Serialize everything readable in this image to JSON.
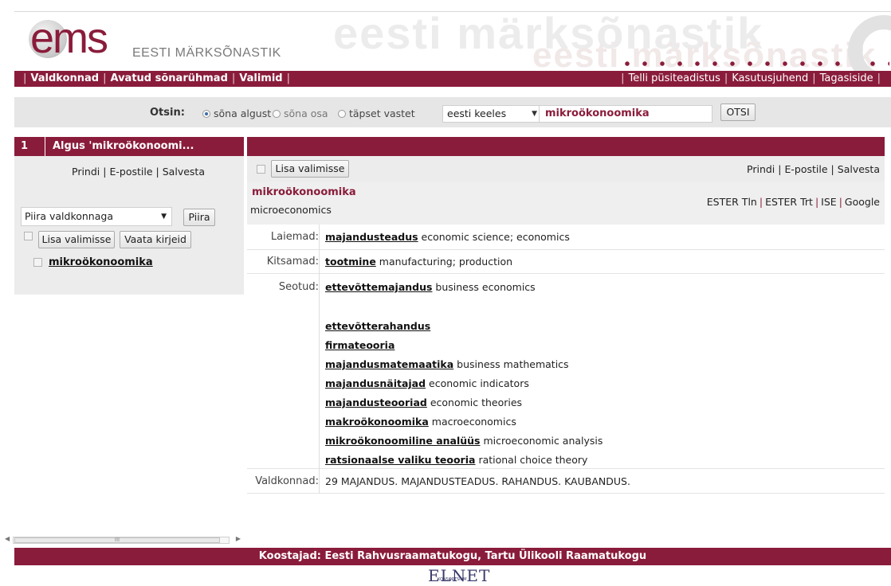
{
  "brand": {
    "logo_text": "ems",
    "subtitle": "EESTI MÄRKSÕNASTIK",
    "watermark_title": "eesti märksõnastik",
    "watermark_sub": "eesti märksõnastik"
  },
  "nav": {
    "left": [
      "Valdkonnad",
      "Avatud sõnarühmad",
      "Valimid"
    ],
    "right": [
      "Telli püsiteadistus",
      "Kasutusjuhend",
      "Tagasiside"
    ]
  },
  "search": {
    "label": "Otsin:",
    "options": [
      "sõna algust",
      "sõna osa",
      "täpset vastet"
    ],
    "selected_option": "sõna algust",
    "language": "eesti keeles",
    "query": "mikroökonoomika",
    "button": "OTSI"
  },
  "left_panel": {
    "number": "1",
    "title": "Algus 'mikroökonoomi...",
    "links": [
      "Prindi",
      "E-postile",
      "Salvesta"
    ],
    "filter_select": "Piira valdkonnaga",
    "filter_button": "Piira",
    "add_button": "Lisa valimisse",
    "view_button": "Vaata kirjeid",
    "result_term": "mikroökonoomika"
  },
  "right_panel": {
    "add_button": "Lisa valimisse",
    "links": [
      "Prindi",
      "E-postile",
      "Salvesta"
    ],
    "term": "mikroökonoomika",
    "translation": "microeconomics",
    "external": [
      "ESTER Tln",
      "ESTER Trt",
      "ISE",
      "Google"
    ],
    "laiemad": {
      "label": "Laiemad:",
      "term": "majandusteadus",
      "en": "economic science; economics"
    },
    "kitsamad": {
      "label": "Kitsamad:",
      "term": "tootmine",
      "en": "manufacturing; production"
    },
    "seotud": {
      "label": "Seotud:",
      "first": {
        "term": "ettevõttemajandus",
        "en": "business economics"
      },
      "items": [
        {
          "term": "ettevõtterahandus",
          "en": ""
        },
        {
          "term": "firmateooria",
          "en": ""
        },
        {
          "term": "majandusmatemaatika",
          "en": "business mathematics"
        },
        {
          "term": "majandusnäitajad",
          "en": "economic indicators"
        },
        {
          "term": "majandusteooriad",
          "en": "economic theories"
        },
        {
          "term": "makroökonoomika",
          "en": "macroeconomics"
        },
        {
          "term": "mikroökonoomiline analüüs",
          "en": "microeconomic analysis"
        },
        {
          "term": "ratsionaalse valiku teooria",
          "en": "rational choice theory"
        }
      ]
    },
    "valdkonnad": {
      "label": "Valdkonnad:",
      "value": "29 MAJANDUS. MAJANDUSTEADUS. RAHANDUS. KAUBANDUS."
    }
  },
  "scrollbar": {
    "thumb_label": "III"
  },
  "footer": {
    "text": "Koostajad: Eesti Rahvusraamatukogu, Tartu Ülikooli Raamatukogu",
    "logo": "ELNET",
    "logo_sub": "KONSORTSIUM"
  },
  "colors": {
    "brand": "#8a1c3b",
    "panel": "#ececec",
    "search_bg": "#e6e6e6"
  }
}
